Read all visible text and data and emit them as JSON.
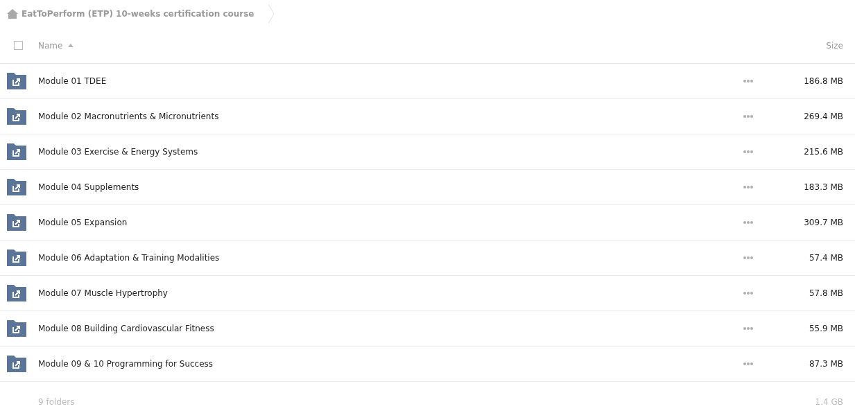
{
  "breadcrumb": {
    "label": "EatToPerform (ETP) 10-weeks certification course"
  },
  "table": {
    "select_all": {
      "checked": false
    },
    "columns": [
      "Name",
      "Size"
    ],
    "rows": [
      {
        "name": "Module 01 TDEE",
        "size": "186.8 MB"
      },
      {
        "name": "Module 02 Macronutrients & Micronutrients",
        "size": "269.4 MB"
      },
      {
        "name": "Module 03 Exercise & Energy Systems",
        "size": "215.6 MB"
      },
      {
        "name": "Module 04 Supplements",
        "size": "183.3 MB"
      },
      {
        "name": "Module 05 Expansion",
        "size": "309.7 MB"
      },
      {
        "name": "Module 06 Adaptation & Training Modalities",
        "size": "57.4 MB"
      },
      {
        "name": "Module 07 Muscle Hypertrophy",
        "size": "57.8 MB"
      },
      {
        "name": "Module 08 Building Cardiovascular Fitness",
        "size": "55.9 MB"
      },
      {
        "name": "Module 09 & 10 Programming for Success",
        "size": "87.3 MB"
      }
    ]
  },
  "footer": {
    "count": "9 folders",
    "total": "1.4 GB"
  }
}
